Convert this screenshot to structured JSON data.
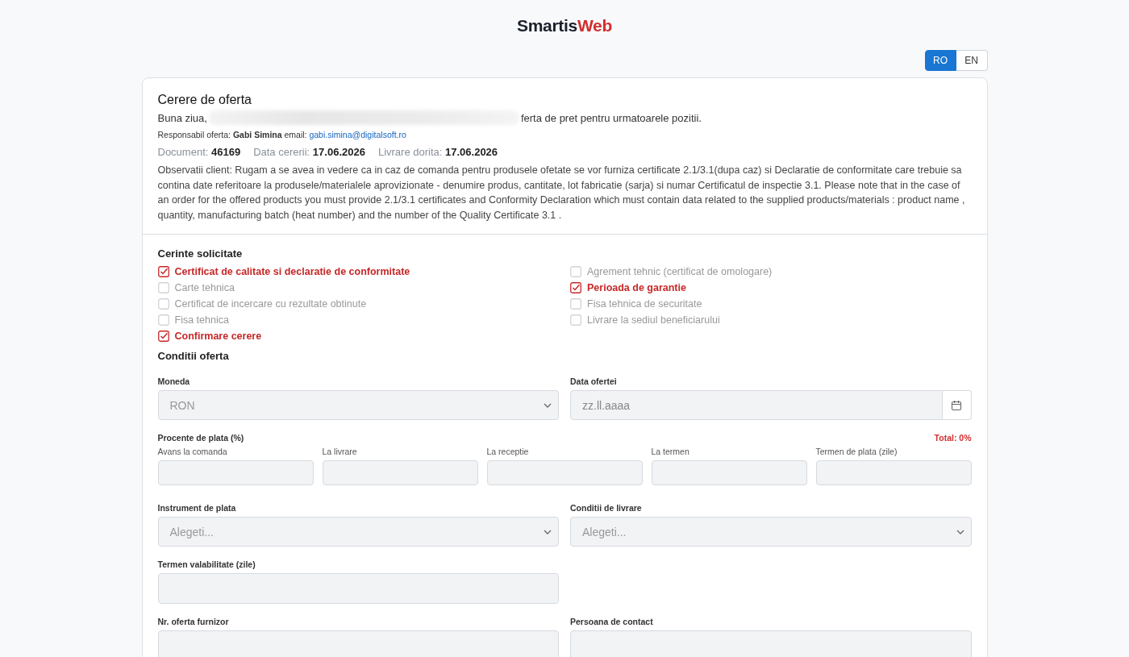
{
  "logo": {
    "first": "Smartis",
    "second": "Web"
  },
  "languages": [
    {
      "label": "RO",
      "selected": true
    },
    {
      "label": "EN",
      "selected": false
    }
  ],
  "request": {
    "title": "Cerere de oferta",
    "greeting_start": "Buna ziua,",
    "greeting_end": "ferta de pret pentru urmatoarele pozitii.",
    "responsible": "Responsabil oferta: **Gabi Simina** email: ",
    "email": "gabi.simina@digitalsoft.ro",
    "meta": [
      {
        "label": "Document:",
        "value": "46169"
      },
      {
        "label": "Data cererii:",
        "value": "17.06.2026"
      },
      {
        "label": "Livrare dorita:",
        "value": "17.06.2026"
      }
    ],
    "observations": "Observatii client: Rugam a se avea in vedere ca in caz de comanda pentru produsele ofetate se vor furniza certificate 2.1/3.1(dupa caz) si Declaratie de conformitate care trebuie sa contina date referitoare la produsele/materialele aprovizionate - denumire produs, cantitate, lot fabricatie (sarja) si numar Certificatul de inspectie 3.1. Please note that in the case of an order for the offered products you must provide 2.1/3.1 certificates and Conformity Declaration which must contain data related to the supplied products/materials : product name , quantity, manufacturing batch (heat number) and the number of the Quality Certificate 3.1 ."
  },
  "requirements": {
    "title": "Cerinte solicitate",
    "items": [
      {
        "label": "Certificat de calitate si declaratie de conformitate",
        "checked": true
      },
      {
        "label": "Agrement tehnic (certificat de omologare)",
        "checked": false
      },
      {
        "label": "Carte tehnica",
        "checked": false
      },
      {
        "label": "Perioada de garantie",
        "checked": true
      },
      {
        "label": "Certificat de incercare cu rezultate obtinute",
        "checked": false
      },
      {
        "label": "Fisa tehnica de securitate",
        "checked": false
      },
      {
        "label": "Fisa tehnica",
        "checked": false
      },
      {
        "label": "Livrare la sediul beneficiarului",
        "checked": false
      },
      {
        "label": "Confirmare cerere",
        "checked": true
      }
    ]
  },
  "conditions": {
    "title": "Conditii oferta",
    "currency": {
      "label": "Moneda",
      "value": "RON",
      "disabled": true
    },
    "offer_date": {
      "label": "Data ofertei",
      "placeholder": "zz.ll.aaaa",
      "disabled": true
    },
    "percentages": {
      "label": "Procente de plata (%)",
      "total": "Total: 0%",
      "fields": [
        {
          "label": "Avans la comanda",
          "disabled": true
        },
        {
          "label": "La livrare",
          "disabled": true
        },
        {
          "label": "La receptie",
          "disabled": true
        },
        {
          "label": "La termen",
          "disabled": true
        },
        {
          "label": "Termen de plata (zile)",
          "disabled": true
        }
      ]
    },
    "payment_instrument": {
      "label": "Instrument de plata",
      "placeholder": "Alegeti...",
      "disabled": true
    },
    "delivery_terms": {
      "label": "Conditii de livrare",
      "placeholder": "Alegeti...",
      "disabled": true
    },
    "validity": {
      "label": "Termen valabilitate (zile)",
      "disabled": true
    },
    "supplier_offer_no": {
      "label": "Nr. oferta furnizor",
      "disabled": true
    },
    "contact_person": {
      "label": "Persoana de contact",
      "disabled": true
    }
  }
}
